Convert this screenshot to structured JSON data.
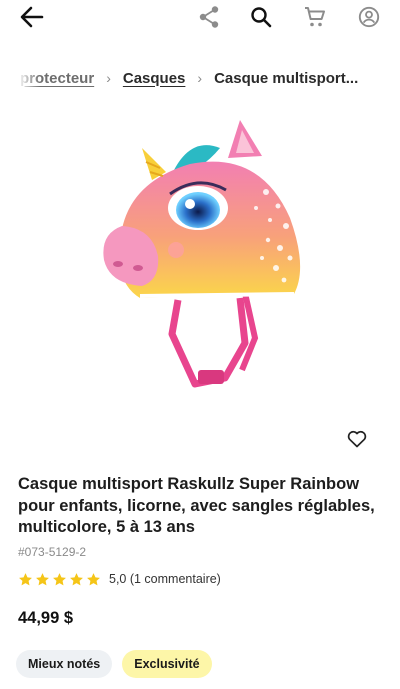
{
  "header": {
    "icons": [
      "back-arrow-icon",
      "share-icon",
      "search-icon",
      "cart-icon",
      "account-icon"
    ]
  },
  "breadcrumb": {
    "items": [
      "protecteur",
      "Casques"
    ],
    "current": "Casque multisport..."
  },
  "product": {
    "title": "Casque multisport Raskullz Super Rainbow pour enfants, licorne, avec sangles réglables, multicolore, 5 à 13 ans",
    "sku": "#073-5129-2",
    "rating_value": 5,
    "rating_text": "5,0 (1 commentaire)",
    "price": "44,99 $",
    "badges": [
      "Mieux notés",
      "Exclusivité"
    ]
  },
  "colors": {
    "star": "#f5c518",
    "badge_grey": "#eef1f4",
    "badge_yellow": "#fdf6a8"
  }
}
